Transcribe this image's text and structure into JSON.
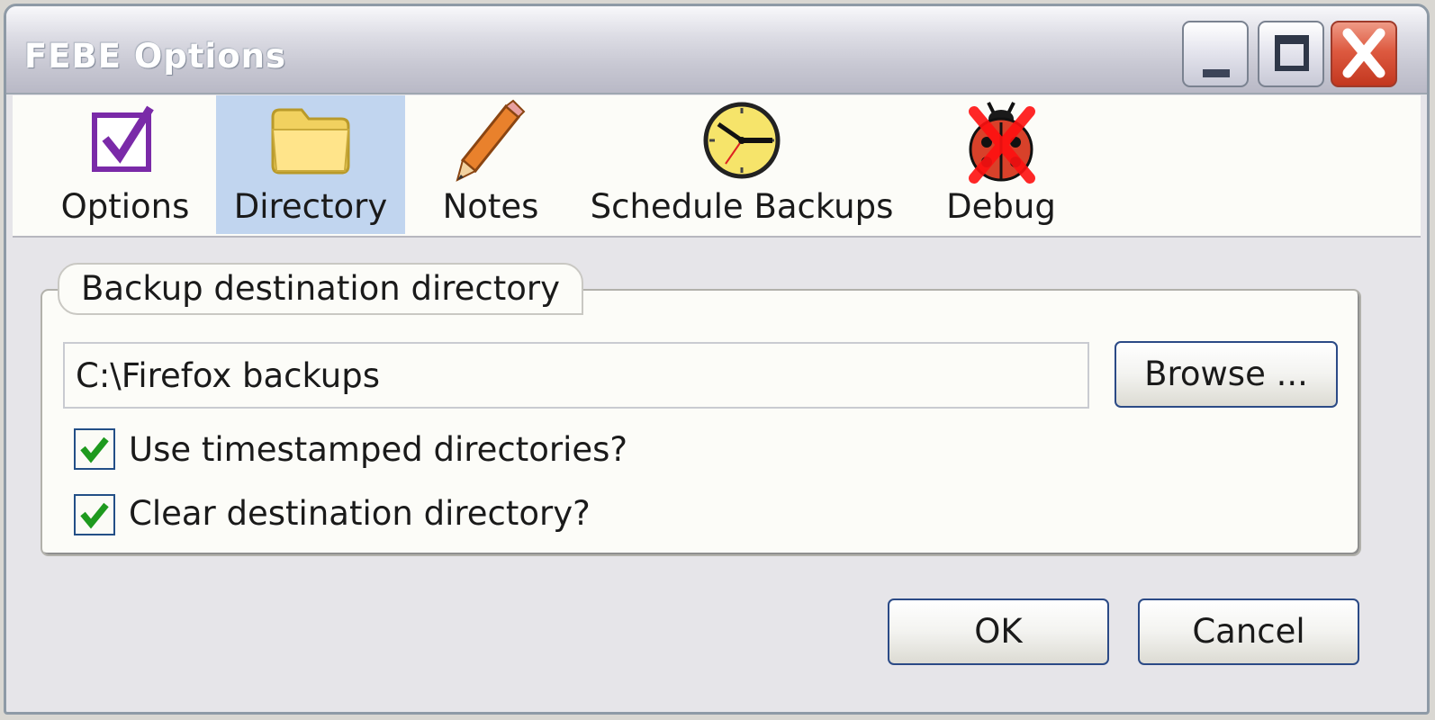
{
  "window": {
    "title": "FEBE Options"
  },
  "toolbar": {
    "tabs": [
      {
        "label": "Options",
        "icon": "checkbox-icon"
      },
      {
        "label": "Directory",
        "icon": "folder-icon",
        "selected": true
      },
      {
        "label": "Notes",
        "icon": "pencil-icon"
      },
      {
        "label": "Schedule Backups",
        "icon": "clock-icon"
      },
      {
        "label": "Debug",
        "icon": "ladybug-disabled-icon"
      }
    ]
  },
  "group": {
    "legend": "Backup destination directory",
    "path_value": "C:\\Firefox backups",
    "browse_label": "Browse ...",
    "checkboxes": [
      {
        "label": "Use timestamped directories?",
        "checked": true
      },
      {
        "label": "Clear destination directory?",
        "checked": true
      }
    ]
  },
  "footer": {
    "ok_label": "OK",
    "cancel_label": "Cancel"
  },
  "colors": {
    "selected_tab": "#c1d5ef",
    "check_green": "#1e9a1e",
    "button_border": "#2b4a86"
  }
}
